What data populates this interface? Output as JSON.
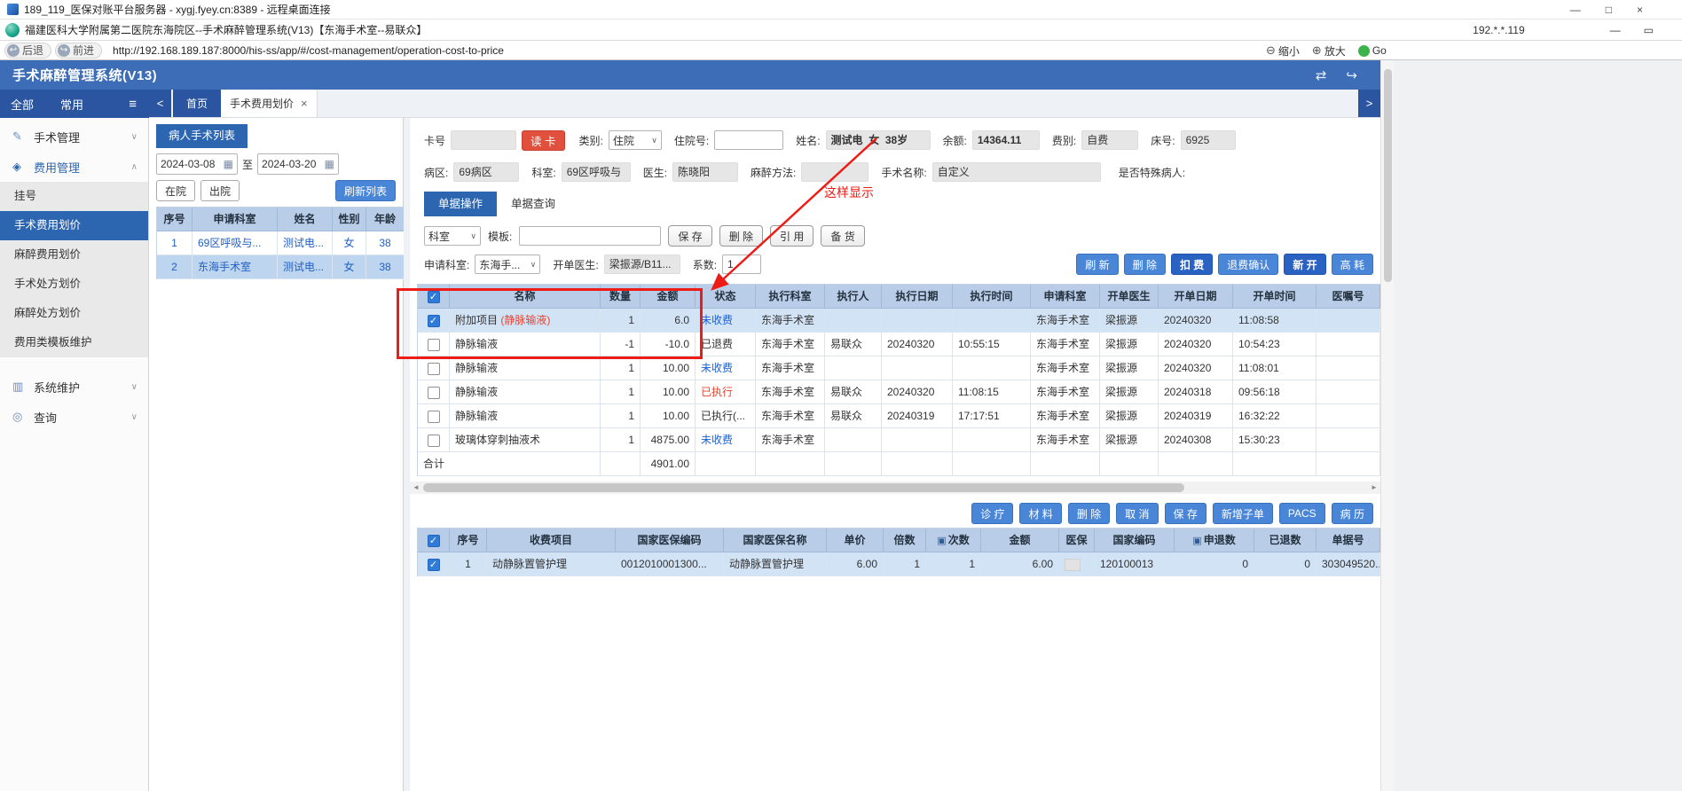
{
  "colors": {
    "accent_blue": "#2d66b0",
    "header_blue": "#3c6db6",
    "table_header": "#b9cde8",
    "selected_row": "#d2e3f6",
    "button_blue": "#4a86d8",
    "button_dark_blue": "#2a62c4",
    "read_card_red": "#e0503c",
    "status_unpaid_blue": "#1761d8",
    "status_executed_red": "#e8432e",
    "annotation_red": "#ed1c16",
    "link_blue": "#2160c4"
  },
  "icons": {
    "check": "✓",
    "dropdown": "∨",
    "chevron_up": "∧",
    "chevron_down": "∨",
    "calendar": "▦",
    "menu": "≡",
    "surgery_group": "✎",
    "fee_group": "◈",
    "system_group": "▥",
    "query_group": "◎",
    "back_arrow": "↩",
    "forward_arrow": "↪",
    "zoom_out": "⊖",
    "zoom_in": "⊕",
    "plugin": "⇄",
    "logout": "↪",
    "close": "×",
    "tab_left": "<",
    "tab_right": ">",
    "scroll_left": "◄",
    "scroll_right": "►",
    "minimize": "—",
    "maximize": "□",
    "restore": "▭",
    "editable": "▣"
  },
  "rdp_bar": {
    "title": "189_119_医保对账平台服务器 - xygj.fyey.cn:8389 - 远程桌面连接"
  },
  "app_bar": {
    "title": "福建医科大学附属第二医院东海院区--手术麻醉管理系统(V13)【东海手术室--易联众】",
    "ip": "192.*.*.119"
  },
  "browser_bar": {
    "back": "后退",
    "forward": "前进",
    "url": "http://192.168.189.187:8000/his-ss/app/#/cost-management/operation-cost-to-price",
    "zoom_out": "缩小",
    "zoom_in": "放大",
    "go": "Go"
  },
  "app_header": {
    "title": "手术麻醉管理系统(V13)"
  },
  "sidebar": {
    "tab_all": "全部",
    "tab_common": "常用",
    "group_surgery": "手术管理",
    "group_fee": "费用管理",
    "items": [
      "挂号",
      "手术费用划价",
      "麻醉费用划价",
      "手术处方划价",
      "麻醉处方划价",
      "费用类模板维护"
    ],
    "group_system": "系统维护",
    "group_query": "查询"
  },
  "tabbar": {
    "home": "首页",
    "active_tab": "手术费用划价"
  },
  "patient_panel": {
    "title": "病人手术列表",
    "date_from": "2024-03-08",
    "date_to": "2024-03-20",
    "range_sep": "至",
    "in_hospital": "在院",
    "out_hospital": "出院",
    "refresh_list": "刷新列表",
    "headers": [
      "序号",
      "申请科室",
      "姓名",
      "性别",
      "年龄"
    ],
    "rows": [
      {
        "cells": [
          "1",
          "69区呼吸与...",
          "测试电...",
          "女",
          "38"
        ],
        "selected": false
      },
      {
        "cells": [
          "2",
          "东海手术室",
          "测试电...",
          "女",
          "38"
        ],
        "selected": true
      }
    ]
  },
  "patient_info": {
    "card_label": "卡号",
    "card_value": "",
    "read_card": "读 卡",
    "type_label": "类别:",
    "type_value": "住院",
    "admission_label": "住院号:",
    "admission_value": "",
    "name_label": "姓名:",
    "name_value": "测试电  女  38岁",
    "balance_label": "余额:",
    "balance_value": "14364.11",
    "fee_label": "费别:",
    "fee_value": "自费",
    "bed_label": "床号:",
    "bed_value": "6925",
    "ward_label": "病区:",
    "ward_value": "69病区",
    "dept_label": "科室:",
    "dept_value": "69区呼吸与",
    "doctor_label": "医生:",
    "doctor_value": "陈晓阳",
    "anesthesia_label": "麻醉方法:",
    "anesthesia_value": "",
    "operation_label": "手术名称:",
    "operation_value": "自定义",
    "special_label": "是否特殊病人:"
  },
  "annotation": {
    "text": "这样显示"
  },
  "doc_tabs": {
    "operate": "单据操作",
    "query": "单据查询"
  },
  "toolbar": {
    "dept_select": "科室",
    "template_label": "模板:",
    "template_value": "",
    "save": "保 存",
    "delete": "删 除",
    "quote": "引 用",
    "stock": "备 货",
    "apply_dept_label": "申请科室:",
    "apply_dept_value": "东海手...",
    "order_doctor_label": "开单医生:",
    "order_doctor_value": "梁振源/B11...",
    "factor_label": "系数:",
    "factor_value": "1",
    "refresh": "刷 新",
    "delete2": "删 除",
    "charge": "扣 费",
    "refund_confirm": "退费确认",
    "new_open": "新 开",
    "high_cost": "高 耗"
  },
  "main_table": {
    "headers": [
      "名称",
      "数量",
      "金额",
      "状态",
      "执行科室",
      "执行人",
      "执行日期",
      "执行时间",
      "申请科室",
      "开单医生",
      "开单日期",
      "开单时间",
      "医嘱号"
    ],
    "rows": [
      {
        "checked": true,
        "selected": true,
        "name": "附加项目 ",
        "name_red": "(静脉输液)",
        "qty": "1",
        "amount": "6.0",
        "status": "未收费",
        "status_color": "blue",
        "exec_dept": "东海手术室",
        "exec_person": "",
        "exec_date": "",
        "exec_time": "",
        "apply_dept": "东海手术室",
        "doctor": "梁振源",
        "order_date": "20240320",
        "order_time": "11:08:58",
        "order_no": ""
      },
      {
        "checked": false,
        "selected": false,
        "name": "静脉输液",
        "qty": "-1",
        "amount": "-10.0",
        "status": "已退费",
        "status_color": "dark",
        "exec_dept": "东海手术室",
        "exec_person": "易联众",
        "exec_date": "20240320",
        "exec_time": "10:55:15",
        "apply_dept": "东海手术室",
        "doctor": "梁振源",
        "order_date": "20240320",
        "order_time": "10:54:23",
        "order_no": ""
      },
      {
        "checked": false,
        "selected": false,
        "name": "静脉输液",
        "qty": "1",
        "amount": "10.00",
        "status": "未收费",
        "status_color": "blue",
        "exec_dept": "东海手术室",
        "exec_person": "",
        "exec_date": "",
        "exec_time": "",
        "apply_dept": "东海手术室",
        "doctor": "梁振源",
        "order_date": "20240320",
        "order_time": "11:08:01",
        "order_no": ""
      },
      {
        "checked": false,
        "selected": false,
        "name": "静脉输液",
        "qty": "1",
        "amount": "10.00",
        "status": "已执行",
        "status_color": "red",
        "exec_dept": "东海手术室",
        "exec_person": "易联众",
        "exec_date": "20240320",
        "exec_time": "11:08:15",
        "apply_dept": "东海手术室",
        "doctor": "梁振源",
        "order_date": "20240318",
        "order_time": "09:56:18",
        "order_no": ""
      },
      {
        "checked": false,
        "selected": false,
        "name": "静脉输液",
        "qty": "1",
        "amount": "10.00",
        "status": "已执行(...",
        "status_color": "dark",
        "exec_dept": "东海手术室",
        "exec_person": "易联众",
        "exec_date": "20240319",
        "exec_time": "17:17:51",
        "apply_dept": "东海手术室",
        "doctor": "梁振源",
        "order_date": "20240319",
        "order_time": "16:32:22",
        "order_no": ""
      },
      {
        "checked": false,
        "selected": false,
        "name": "玻璃体穿刺抽液术",
        "qty": "1",
        "amount": "4875.00",
        "status": "未收费",
        "status_color": "blue",
        "exec_dept": "东海手术室",
        "exec_person": "",
        "exec_date": "",
        "exec_time": "",
        "apply_dept": "东海手术室",
        "doctor": "梁振源",
        "order_date": "20240308",
        "order_time": "15:30:23",
        "order_no": ""
      }
    ],
    "total_label": "合计",
    "total_amount": "4901.00"
  },
  "bottom_buttons": [
    "诊 疗",
    "材 料",
    "删 除",
    "取 消",
    "保 存",
    "新增子单",
    "PACS",
    "病 历"
  ],
  "bottom_table": {
    "headers": [
      {
        "label": "序号"
      },
      {
        "label": "收费项目"
      },
      {
        "label": "国家医保编码"
      },
      {
        "label": "国家医保名称"
      },
      {
        "label": "单价"
      },
      {
        "label": "倍数"
      },
      {
        "label": "次数",
        "icon": true
      },
      {
        "label": "金额"
      },
      {
        "label": "医保"
      },
      {
        "label": "国家编码"
      },
      {
        "label": "申退数",
        "icon": true
      },
      {
        "label": "已退数"
      },
      {
        "label": "单据号"
      }
    ],
    "rows": [
      {
        "checked": true,
        "selected": true,
        "cells": [
          "1",
          "动静脉置管护理",
          "0012010001300...",
          "动静脉置管护理",
          "6.00",
          "1",
          "1",
          "6.00",
          "",
          "120100013",
          "0",
          "0",
          "303049520..."
        ]
      }
    ]
  }
}
